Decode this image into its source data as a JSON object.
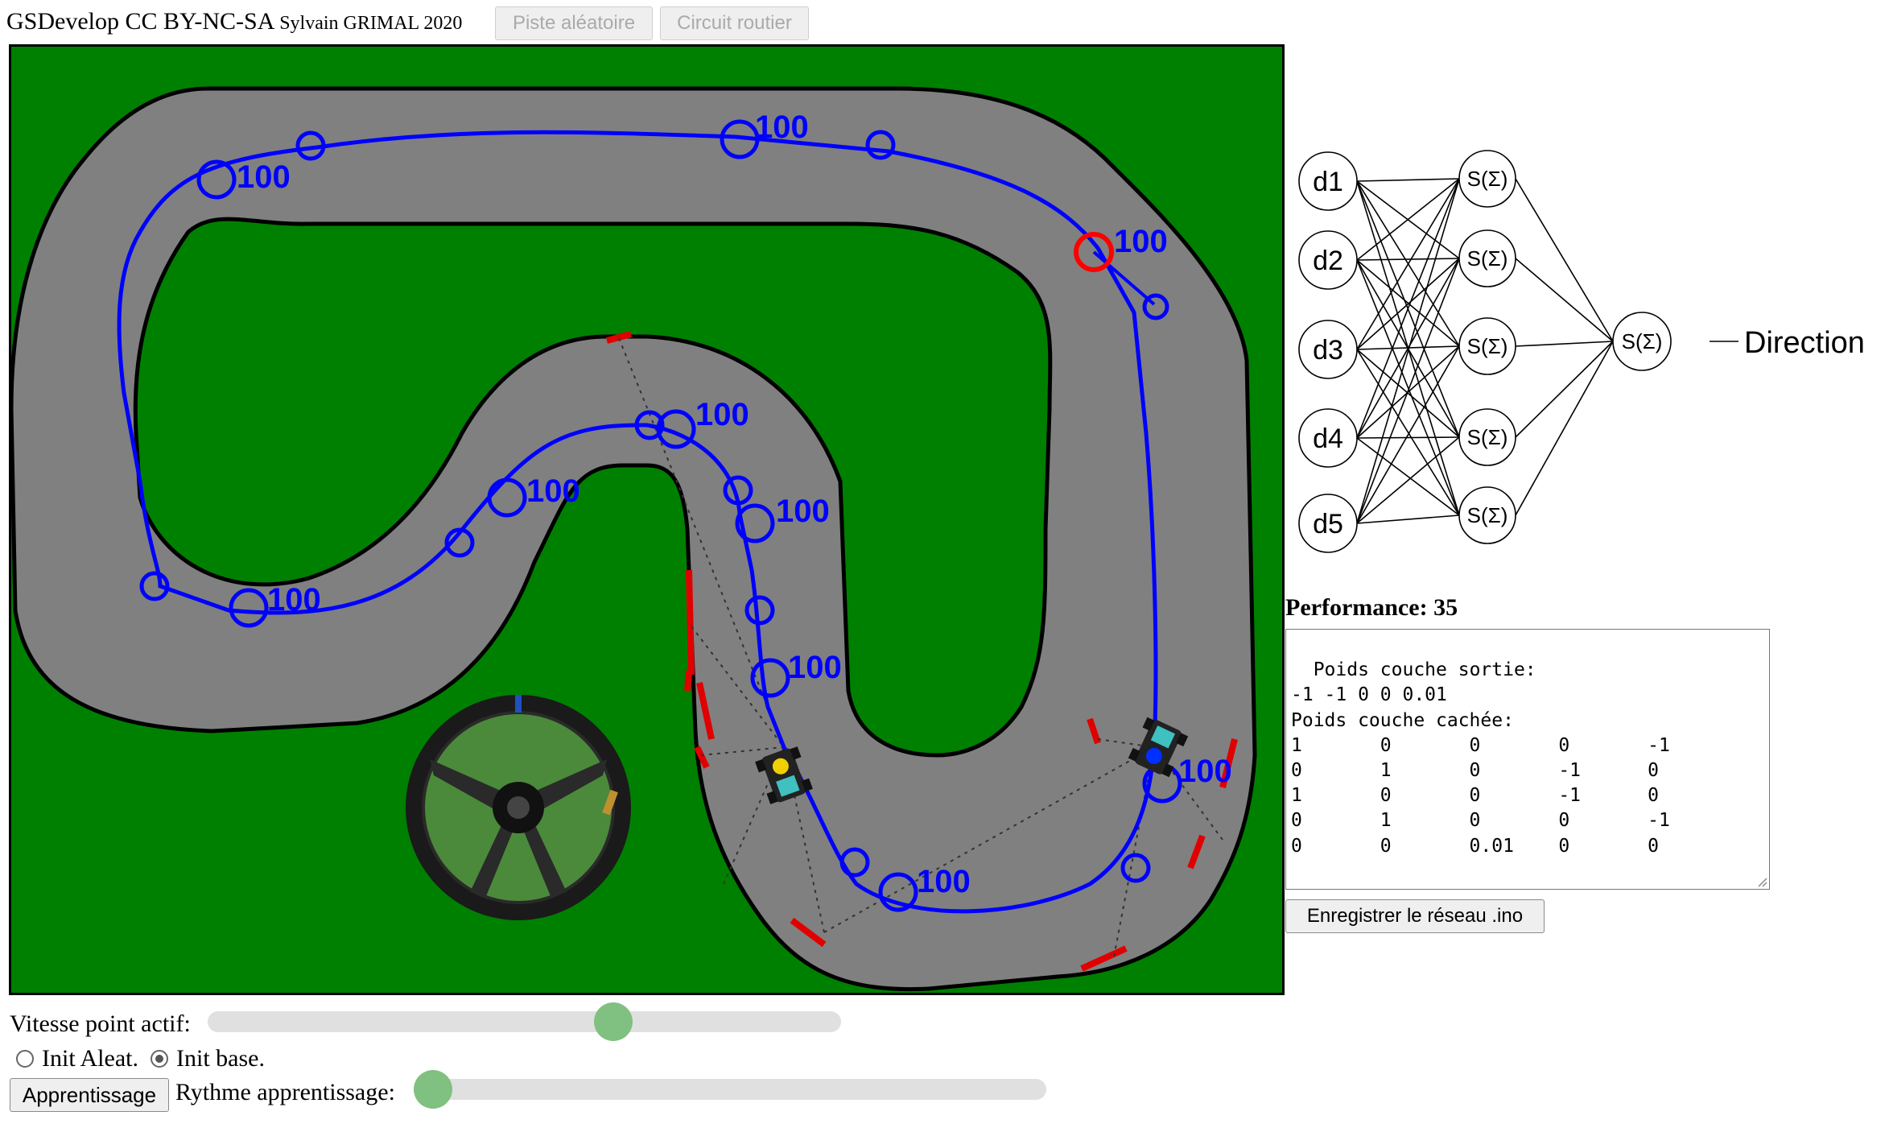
{
  "header": {
    "brand": "GSDevelop CC BY-NC-SA",
    "author": "Sylvain GRIMAL 2020",
    "btn_random_track": "Piste aléatoire",
    "btn_road_circuit": "Circuit routier"
  },
  "track": {
    "checkpoint_label": "100",
    "colors": {
      "grass": "#008000",
      "road": "#808080",
      "path": "#0000ff",
      "active": "#ff0000"
    }
  },
  "network": {
    "inputs": [
      "d1",
      "d2",
      "d3",
      "d4",
      "d5"
    ],
    "hidden_label": "S(Σ)",
    "output_label": "S(Σ)",
    "output_name": "Direction"
  },
  "performance": {
    "label": "Performance:",
    "value": "35"
  },
  "weights": {
    "text": "Poids couche sortie:\n-1 -1 0 0 0.01\nPoids couche cachée:\n1       0       0       0       -1\n0       1       0       -1      0\n1       0       0       -1      0\n0       1       0       0       -1\n0       0       0.01    0       0"
  },
  "save_button": "Enregistrer le réseau .ino",
  "controls": {
    "speed_label": "Vitesse point actif:",
    "speed_value": 0.65,
    "init_random": "Init Aleat.",
    "init_base": "Init base.",
    "init_selected": "base",
    "learn_button": "Apprentissage",
    "rate_label": "Rythme apprentissage:",
    "rate_value": 0.0
  }
}
